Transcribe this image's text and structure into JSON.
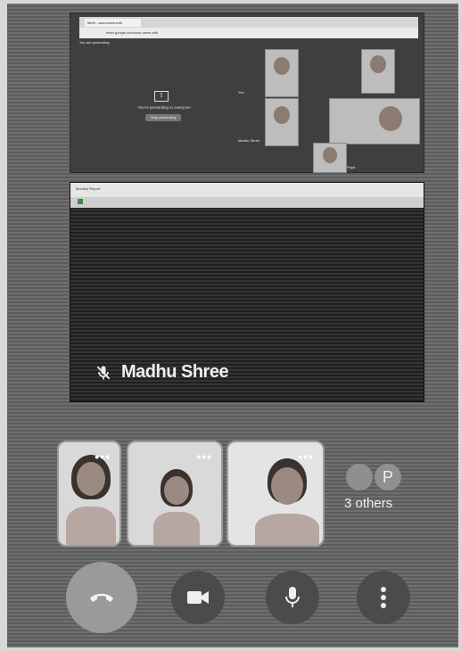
{
  "top_screen": {
    "browser_tab_label": "Meet - wou-nzem-edh",
    "url_text": "meet.google.com/wou-nzem-edh",
    "meet_bar_label": "You are presenting",
    "stop_text": "You're presenting to everyone",
    "stop_button": "Stop presenting",
    "mini_labels": [
      "You",
      "Madhu Shree",
      "Priya"
    ]
  },
  "shared_doc": {
    "title": "Monthly Report"
  },
  "presenter": {
    "name": "Madhu Shree",
    "mic_icon": "mic-off-icon"
  },
  "participants": {
    "tiles": [
      {
        "dots": "•••"
      },
      {
        "dots": "•••"
      },
      {
        "dots": "•••"
      }
    ],
    "others_avatar_letter": "P",
    "others_label": "3 others"
  },
  "controls": {
    "end_call_icon": "phone-hangup-icon",
    "camera_icon": "videocam-icon",
    "mic_icon": "mic-icon",
    "more_icon": "more-vert-icon"
  }
}
